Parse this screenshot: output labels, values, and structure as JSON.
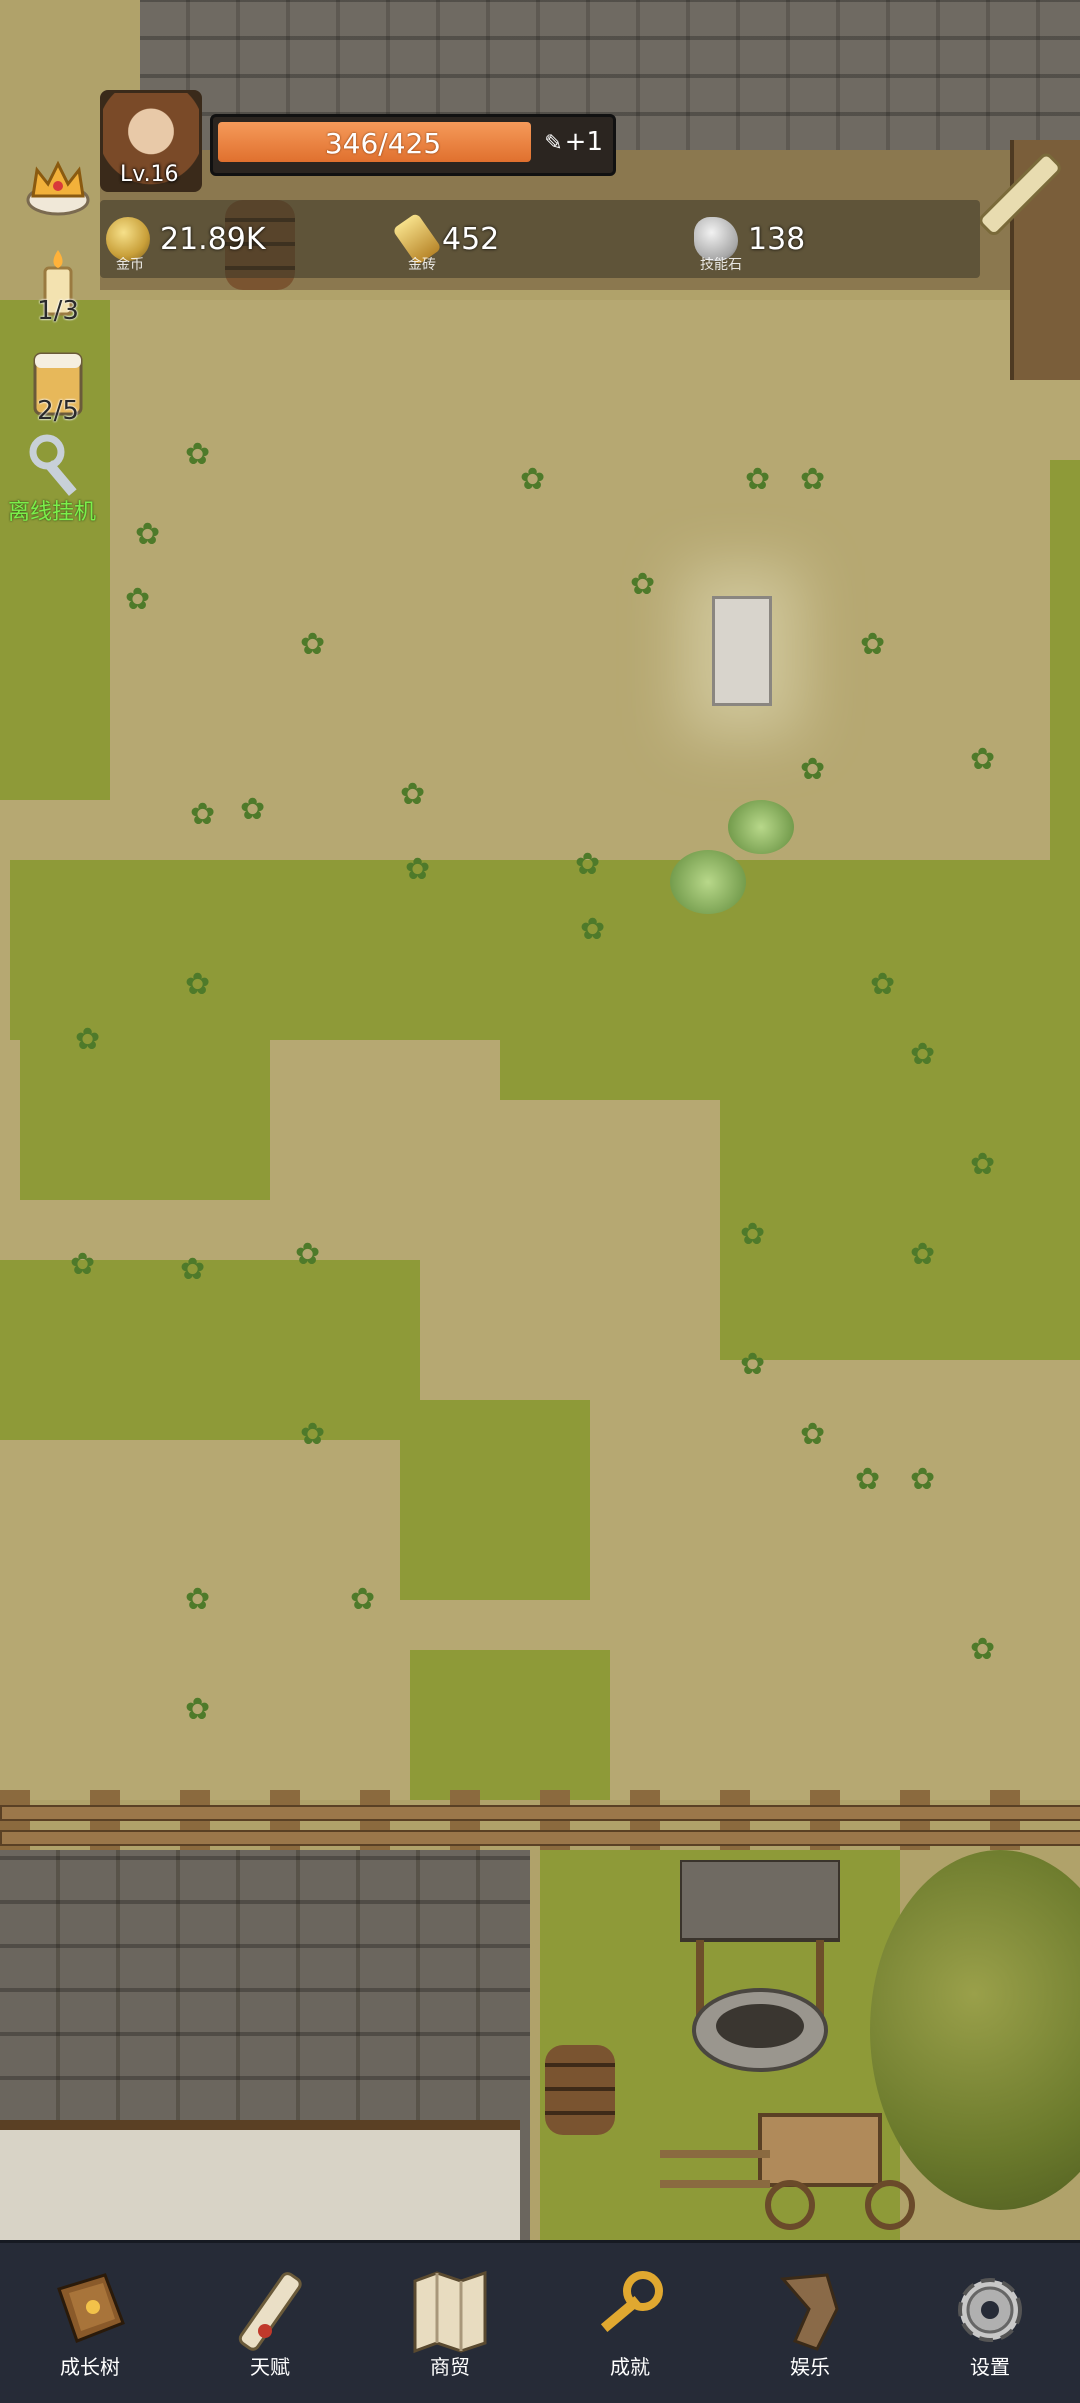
{
  "player": {
    "level": "Lv.16"
  },
  "xp": {
    "text": "346/425",
    "fraction": 0.814,
    "plus": "+1"
  },
  "resources": [
    {
      "icon": "gold-coin-icon",
      "value": "21.89K",
      "label": "金币"
    },
    {
      "icon": "gold-brick-icon",
      "value": "452",
      "label": "金砖"
    },
    {
      "icon": "skill-stone-icon",
      "value": "138",
      "label": "技能石"
    }
  ],
  "side": {
    "candle": "1/3",
    "drink": "2/5",
    "idle": "离线挂机"
  },
  "nav": [
    {
      "label": "成长树",
      "icon": "growth-tree-book-icon"
    },
    {
      "label": "天赋",
      "icon": "talent-scroll-icon"
    },
    {
      "label": "商贸",
      "icon": "trade-map-icon"
    },
    {
      "label": "成就",
      "icon": "achievement-key-icon"
    },
    {
      "label": "娱乐",
      "icon": "entertainment-icon"
    },
    {
      "label": "设置",
      "icon": "settings-gear-icon"
    }
  ],
  "colors": {
    "xp_fill": "#e0702e",
    "nav_bg": "#262b37",
    "idle_text": "#7bf04a"
  }
}
